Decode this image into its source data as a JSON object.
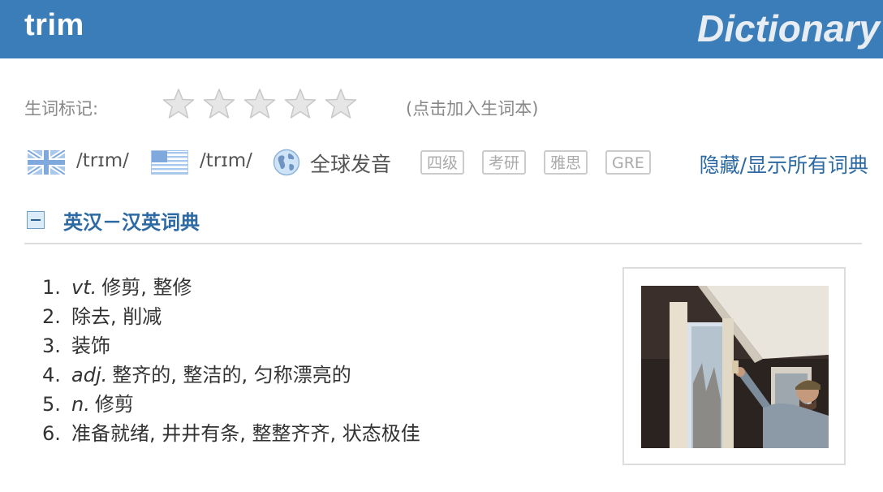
{
  "header": {
    "word": "trim",
    "brand": "Dictionary"
  },
  "wordbook": {
    "label": "生词标记:",
    "star_count": 5,
    "stars_filled": 0,
    "hint": "(点击加入生词本)"
  },
  "pronunciation": {
    "uk_flag_icon": "uk-flag-icon",
    "uk_phonetic": "/trɪm/",
    "us_flag_icon": "us-flag-icon",
    "us_phonetic": "/trɪm/",
    "global_icon": "globe-icon",
    "global_label": "全球发音",
    "tags": [
      "四级",
      "考研",
      "雅思",
      "GRE"
    ],
    "toggle_all": "隐藏/显示所有词典"
  },
  "dictionary_section": {
    "title": "英汉－汉英词典",
    "collapse_icon": "minus-box-icon",
    "definitions": [
      {
        "num": "1.",
        "pos": "vt.",
        "text": "修剪, 整修"
      },
      {
        "num": "2.",
        "pos": "",
        "text": "除去, 削减"
      },
      {
        "num": "3.",
        "pos": "",
        "text": "装饰"
      },
      {
        "num": "4.",
        "pos": "adj.",
        "text": "整齐的, 整洁的, 匀称漂亮的"
      },
      {
        "num": "5.",
        "pos": "n.",
        "text": "修剪"
      },
      {
        "num": "6.",
        "pos": "",
        "text": "准备就绪, 井井有条, 整整齐齐, 状态极佳"
      }
    ],
    "image_description": "photo-of-person-painting-window-trim"
  },
  "colors": {
    "header_bg": "#3b7db8",
    "link": "#2d6aa3",
    "star_fill": "#e6e6e6"
  }
}
